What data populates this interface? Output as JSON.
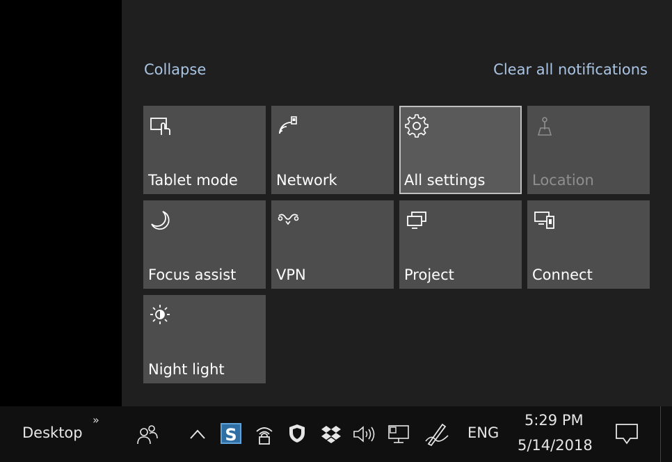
{
  "action_center": {
    "collapse_label": "Collapse",
    "clear_all_label": "Clear all notifications",
    "tiles": [
      {
        "label": "Tablet mode",
        "icon": "tablet-mode-icon"
      },
      {
        "label": "Network",
        "icon": "network-icon"
      },
      {
        "label": "All settings",
        "icon": "gear-icon",
        "selected": true
      },
      {
        "label": "Location",
        "icon": "location-icon",
        "disabled": true
      },
      {
        "label": "Focus assist",
        "icon": "moon-icon"
      },
      {
        "label": "VPN",
        "icon": "vpn-icon"
      },
      {
        "label": "Project",
        "icon": "project-icon"
      },
      {
        "label": "Connect",
        "icon": "connect-icon"
      },
      {
        "label": "Night light",
        "icon": "night-light-icon"
      }
    ]
  },
  "taskbar": {
    "desktop_label": "Desktop",
    "desktop_chevron": "»",
    "store_badge": "S",
    "language": "ENG",
    "time": "5:29 PM",
    "date": "5/14/2018"
  },
  "colors": {
    "tile_bg": "#4d4d4d",
    "link": "#a9c4e4",
    "panel_bg": "#1f1f1f",
    "taskbar_bg": "#101010"
  }
}
